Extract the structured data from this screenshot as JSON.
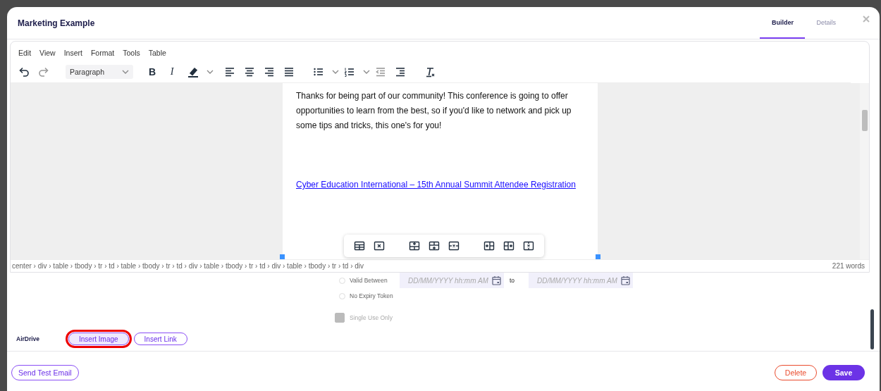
{
  "window": {
    "title": "Marketing Example"
  },
  "tabs": [
    {
      "label": "Builder",
      "selected": true
    },
    {
      "label": "Details",
      "selected": false
    }
  ],
  "menu": [
    "Edit",
    "View",
    "Insert",
    "Format",
    "Tools",
    "Table"
  ],
  "toolbar": {
    "block_format": "Paragraph",
    "bold": "B",
    "italic": "I"
  },
  "content": {
    "paragraph": "Thanks for being part of our community! This conference is going to offer opportunities to learn from the best, so if you'd like to network and pick up some tips and tricks, this one's for you!",
    "link": "Cyber Education International – 15th Annual Summit Attendee Registration"
  },
  "status_bar": {
    "path": "center › div › table › tbody › tr › td › table › tbody › tr › td › div › table › tbody › tr › td › div › table › tbody › tr › td › div",
    "word_count": "221 words"
  },
  "token": {
    "options": [
      {
        "label": "Valid Between",
        "selected": false
      },
      {
        "label": "No Expiry Token",
        "selected": false
      }
    ],
    "from_placeholder": "DD/MM/YYYY hh:mm AM",
    "to_label": "to",
    "to_placeholder": "DD/MM/YYYY hh:mm AM",
    "single_use": {
      "label": "Single Use Only",
      "checked": false,
      "disabled": true
    }
  },
  "airdrive": {
    "label": "AirDrive",
    "buttons": [
      {
        "label": "Insert Image",
        "highlighted": true
      },
      {
        "label": "Insert Link",
        "highlighted": false
      }
    ]
  },
  "footer": {
    "test_button": "Send Test Email",
    "delete_button": "Delete",
    "save_button": "Save"
  }
}
